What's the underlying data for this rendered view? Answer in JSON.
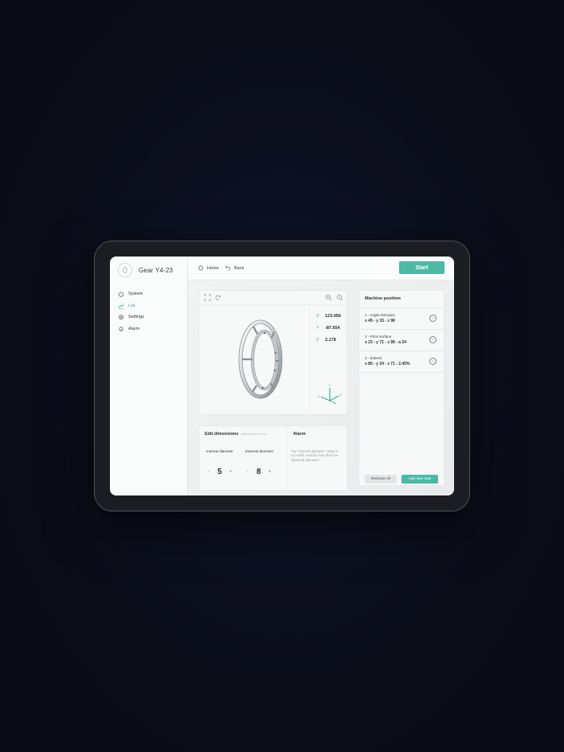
{
  "app": {
    "title": "Gear Y4-23",
    "logo_icon": "gear-logo-icon"
  },
  "sidebar": {
    "items": [
      {
        "label": "System",
        "icon": "power-icon",
        "active": false
      },
      {
        "label": "List",
        "icon": "chart-line-icon",
        "active": true
      },
      {
        "label": "Settings",
        "icon": "gear-icon",
        "active": false
      },
      {
        "label": "Alarm",
        "icon": "bell-icon",
        "active": false
      }
    ]
  },
  "topbar": {
    "home_label": "Home",
    "back_label": "Back",
    "start_label": "Start"
  },
  "viewer": {
    "coordinates": [
      {
        "axis": "X",
        "value": "123.456"
      },
      {
        "axis": "Y",
        "value": "-87.654"
      },
      {
        "axis": "Z",
        "value": "2.178"
      }
    ],
    "axis_labels": {
      "y": "Y",
      "x": "X",
      "z": "Z"
    }
  },
  "dimensions": {
    "title": "Edit dimensions",
    "subtitle": "(Measured in mm)",
    "internal_label": "Internal diameter",
    "external_label": "External diameter",
    "internal_value": "5",
    "external_value": "8",
    "minus": "-",
    "plus": "+"
  },
  "alarm": {
    "title": "Alarm",
    "message": "The \"Internal diameter\" value is not valid, must be less than the \"External diameter\""
  },
  "machine": {
    "title": "Machine position",
    "tasks": [
      {
        "name": "1 - Angle extrusion",
        "coords": "x 45 - y 33 - z 98"
      },
      {
        "name": "2 - Prick surface",
        "coords": "x 23 - y 71 - z 99 - a 34"
      },
      {
        "name": "3 - Extend",
        "coords": "x 85 - y 24 - z 71 - 2.45%"
      }
    ],
    "remove_all_label": "Remove All",
    "add_label": "Add new task"
  },
  "colors": {
    "accent": "#4bb9a4",
    "background": "#0a0c18"
  }
}
